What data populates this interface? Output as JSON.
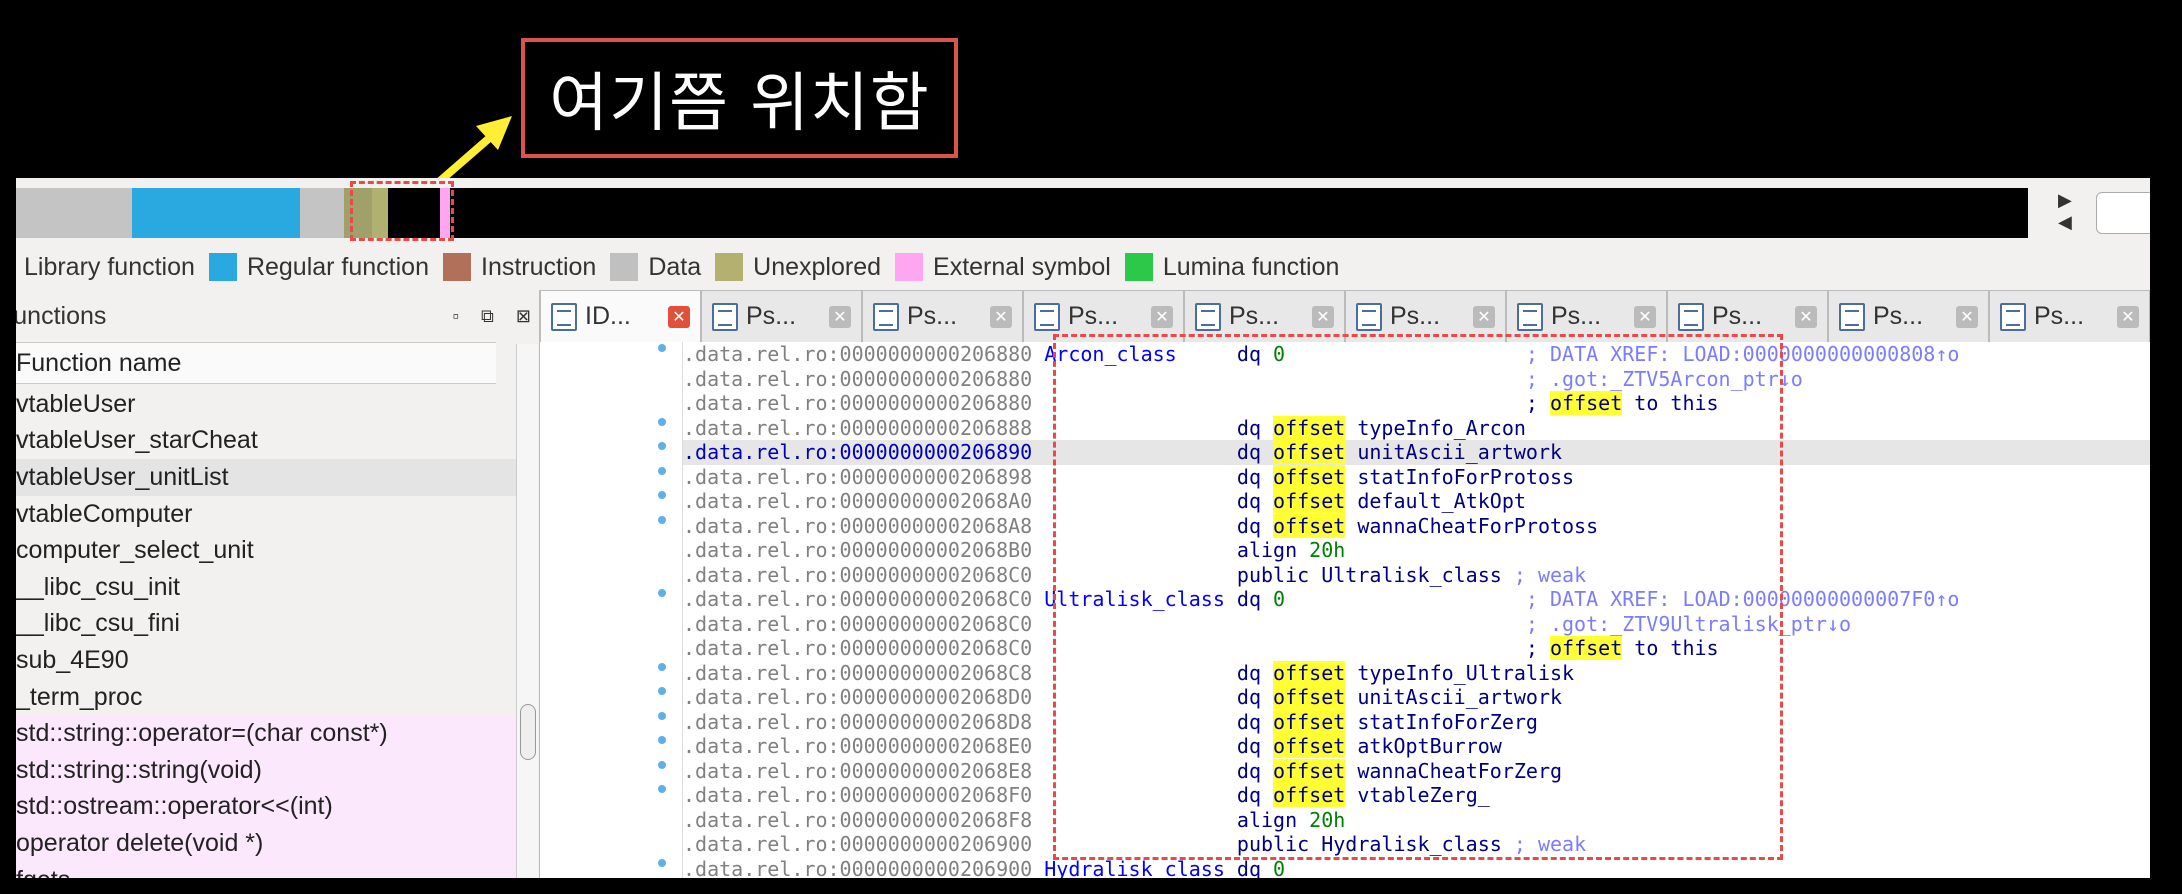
{
  "annotation": {
    "text": "여기쯤 위치함"
  },
  "navband": {
    "colors": [
      "#c4c4c4",
      "#2aa8e0",
      "#c4c4c4",
      "#a0a06a",
      "#b0b070",
      "#000000",
      "#ffa6f0"
    ]
  },
  "legend": [
    {
      "label": "Library function",
      "color": "#2aa8e0",
      "hidden_swatch": true
    },
    {
      "label": "Regular function",
      "color": "#2aa8e0"
    },
    {
      "label": "Instruction",
      "color": "#b0705a"
    },
    {
      "label": "Data",
      "color": "#c0c0c0"
    },
    {
      "label": "Unexplored",
      "color": "#b4b070"
    },
    {
      "label": "External symbol",
      "color": "#ffa6f0"
    },
    {
      "label": "Lumina function",
      "color": "#2cc84a"
    }
  ],
  "functions_panel": {
    "title": "Functions",
    "column_header": "Function name",
    "rows": [
      {
        "name": "vtableUser",
        "style": "normal"
      },
      {
        "name": "vtableUser_starCheat",
        "style": "normal"
      },
      {
        "name": "vtableUser_unitList",
        "style": "sel"
      },
      {
        "name": "vtableComputer",
        "style": "normal"
      },
      {
        "name": "computer_select_unit",
        "style": "normal"
      },
      {
        "name": "__libc_csu_init",
        "style": "normal"
      },
      {
        "name": "__libc_csu_fini",
        "style": "normal"
      },
      {
        "name": "sub_4E90",
        "style": "normal"
      },
      {
        "name": "_term_proc",
        "style": "normal"
      },
      {
        "name": "std::string::operator=(char const*)",
        "style": "pink"
      },
      {
        "name": "std::string::string(void)",
        "style": "pink"
      },
      {
        "name": "std::ostream::operator<<(int)",
        "style": "pink"
      },
      {
        "name": "operator delete(void *)",
        "style": "pink"
      },
      {
        "name": "fgets",
        "style": "pink"
      }
    ]
  },
  "tabs": [
    {
      "label": "ID...",
      "active": true
    },
    {
      "label": "Ps..."
    },
    {
      "label": "Ps..."
    },
    {
      "label": "Ps..."
    },
    {
      "label": "Ps..."
    },
    {
      "label": "Ps..."
    },
    {
      "label": "Ps..."
    },
    {
      "label": "Ps..."
    },
    {
      "label": "Ps..."
    },
    {
      "label": "Ps..."
    }
  ],
  "disasm": {
    "lines": [
      {
        "addr": ".data.rel.ro:0000000000206880",
        "label": "Arcon_class",
        "instr": [
          [
            "kw",
            "dq "
          ],
          [
            "num",
            "0"
          ]
        ],
        "comment": "; DATA XREF: LOAD:0000000000000808↑o",
        "bullet": true
      },
      {
        "addr": ".data.rel.ro:0000000000206880",
        "comment": "; .got:_ZTV5Arcon_ptr↓o"
      },
      {
        "addr": ".data.rel.ro:0000000000206880",
        "comment_parts": [
          [
            "kw",
            "; "
          ],
          [
            "off",
            "offset"
          ],
          [
            "kw",
            " to this"
          ]
        ]
      },
      {
        "addr": ".data.rel.ro:0000000000206888",
        "instr": [
          [
            "kw",
            "dq "
          ],
          [
            "off",
            "offset"
          ],
          [
            "kw",
            " typeInfo_Arcon"
          ]
        ],
        "bullet": true
      },
      {
        "addr": ".data.rel.ro:0000000000206890",
        "cur": true,
        "instr": [
          [
            "kw",
            "dq "
          ],
          [
            "off",
            "offset"
          ],
          [
            "kw",
            " unitAscii_artwork"
          ]
        ],
        "bullet": true
      },
      {
        "addr": ".data.rel.ro:0000000000206898",
        "instr": [
          [
            "kw",
            "dq "
          ],
          [
            "off",
            "offset"
          ],
          [
            "kw",
            " statInfoForProtoss"
          ]
        ],
        "bullet": true
      },
      {
        "addr": ".data.rel.ro:00000000002068A0",
        "instr": [
          [
            "kw",
            "dq "
          ],
          [
            "off",
            "offset"
          ],
          [
            "kw",
            " default_AtkOpt"
          ]
        ],
        "bullet": true
      },
      {
        "addr": ".data.rel.ro:00000000002068A8",
        "instr": [
          [
            "kw",
            "dq "
          ],
          [
            "off",
            "offset"
          ],
          [
            "kw",
            " wannaCheatForProtoss"
          ]
        ],
        "bullet": true
      },
      {
        "addr": ".data.rel.ro:00000000002068B0",
        "instr": [
          [
            "kw",
            "align "
          ],
          [
            "num",
            "20h"
          ]
        ]
      },
      {
        "addr": ".data.rel.ro:00000000002068C0",
        "instr": [
          [
            "kw",
            "public Ultralisk_class "
          ],
          [
            "cmt",
            "; weak"
          ]
        ]
      },
      {
        "addr": ".data.rel.ro:00000000002068C0",
        "label": "Ultralisk_class",
        "instr": [
          [
            "kw",
            "dq "
          ],
          [
            "num",
            "0"
          ]
        ],
        "comment": "; DATA XREF: LOAD:00000000000007F0↑o",
        "bullet": true
      },
      {
        "addr": ".data.rel.ro:00000000002068C0",
        "comment": "; .got:_ZTV9Ultralisk_ptr↓o"
      },
      {
        "addr": ".data.rel.ro:00000000002068C0",
        "comment_parts": [
          [
            "kw",
            "; "
          ],
          [
            "off",
            "offset"
          ],
          [
            "kw",
            " to this"
          ]
        ]
      },
      {
        "addr": ".data.rel.ro:00000000002068C8",
        "instr": [
          [
            "kw",
            "dq "
          ],
          [
            "off",
            "offset"
          ],
          [
            "kw",
            " typeInfo_Ultralisk"
          ]
        ],
        "bullet": true
      },
      {
        "addr": ".data.rel.ro:00000000002068D0",
        "instr": [
          [
            "kw",
            "dq "
          ],
          [
            "off",
            "offset"
          ],
          [
            "kw",
            " unitAscii_artwork"
          ]
        ],
        "bullet": true
      },
      {
        "addr": ".data.rel.ro:00000000002068D8",
        "instr": [
          [
            "kw",
            "dq "
          ],
          [
            "off",
            "offset"
          ],
          [
            "kw",
            " statInfoForZerg"
          ]
        ],
        "bullet": true
      },
      {
        "addr": ".data.rel.ro:00000000002068E0",
        "instr": [
          [
            "kw",
            "dq "
          ],
          [
            "off",
            "offset"
          ],
          [
            "kw",
            " atkOptBurrow"
          ]
        ],
        "bullet": true
      },
      {
        "addr": ".data.rel.ro:00000000002068E8",
        "instr": [
          [
            "kw",
            "dq "
          ],
          [
            "off",
            "offset"
          ],
          [
            "kw",
            " wannaCheatForZerg"
          ]
        ],
        "bullet": true
      },
      {
        "addr": ".data.rel.ro:00000000002068F0",
        "instr": [
          [
            "kw",
            "dq "
          ],
          [
            "off",
            "offset"
          ],
          [
            "kw",
            " vtableZerg_"
          ]
        ],
        "bullet": true
      },
      {
        "addr": ".data.rel.ro:00000000002068F8",
        "instr": [
          [
            "kw",
            "align "
          ],
          [
            "num",
            "20h"
          ]
        ]
      },
      {
        "addr": ".data.rel.ro:0000000000206900",
        "instr": [
          [
            "kw",
            "public Hydralisk_class "
          ],
          [
            "cmt",
            "; weak"
          ]
        ]
      },
      {
        "addr": ".data.rel.ro:0000000000206900",
        "label": "Hydralisk_class",
        "instr": [
          [
            "kw",
            "dq "
          ],
          [
            "num",
            "0"
          ]
        ],
        "bullet": true
      }
    ]
  }
}
